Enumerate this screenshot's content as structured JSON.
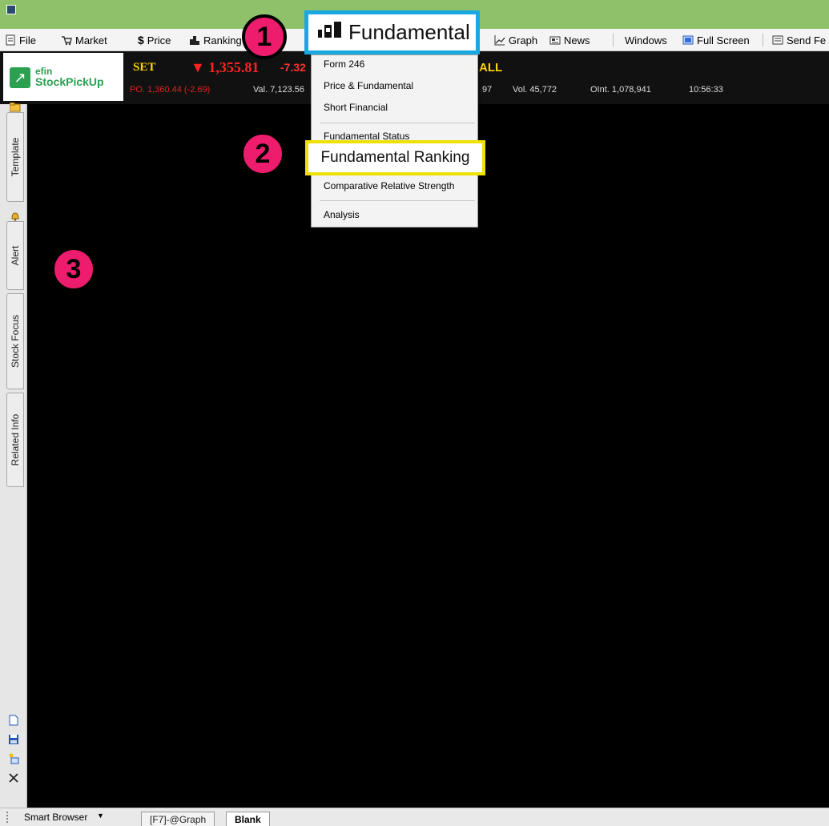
{
  "menubar": {
    "items": [
      {
        "label": "File",
        "icon": "file-icon"
      },
      {
        "label": "Market",
        "icon": "market-icon"
      },
      {
        "label": "Price",
        "icon": "dollar-icon"
      },
      {
        "label": "Ranking",
        "icon": "ranking-icon"
      },
      {
        "label": "Graph",
        "icon": "graph-icon"
      },
      {
        "label": "News",
        "icon": "news-icon"
      },
      {
        "label": "Windows"
      },
      {
        "label": "Full Screen",
        "icon": "fullscreen-icon"
      },
      {
        "label": "Send Fe",
        "icon": "send-feedback-icon"
      }
    ],
    "fundamental_label": "Fundamental"
  },
  "ticker": {
    "logo_efin": "efin",
    "logo_main": "StockPickUp",
    "market": "SET",
    "index": "▼ 1,355.81",
    "change": "-7.32",
    "board": "ALL",
    "prev_close": "PO. 1,360.44 (-2.69)",
    "value": "Val. 7,123.56",
    "value_tail": "97",
    "volume": "Vol. 45,772",
    "open_interest": "OInt. 1,078,941",
    "time": "10:56:33"
  },
  "dropdown": {
    "items": [
      "Form 246",
      "Price & Fundamental",
      "Short Financial",
      "Fundamental Status",
      "Fundamental Ranking",
      "Comparative Relative Strength",
      "Analysis"
    ],
    "highlighted": "Fundamental Ranking"
  },
  "left_tabs": [
    "Template",
    "Alert",
    "Stock Focus",
    "Related Info"
  ],
  "left_tools": [
    "new-document-icon",
    "save-icon",
    "open-icon",
    "close-icon"
  ],
  "bottom": {
    "smart_browser": "Smart Browser",
    "tabs": [
      "[F7]-@Graph",
      "Blank"
    ],
    "active_tab": "Blank"
  },
  "callouts": [
    "1",
    "2",
    "3"
  ],
  "colors": {
    "titlebar": "#8fc16a",
    "fundamental_box_border": "#1aa8e0",
    "ranking_box_border": "#f0e000",
    "badge": "#ee1c6c",
    "index_red": "#ff2222",
    "set_yellow": "#ffd400"
  }
}
